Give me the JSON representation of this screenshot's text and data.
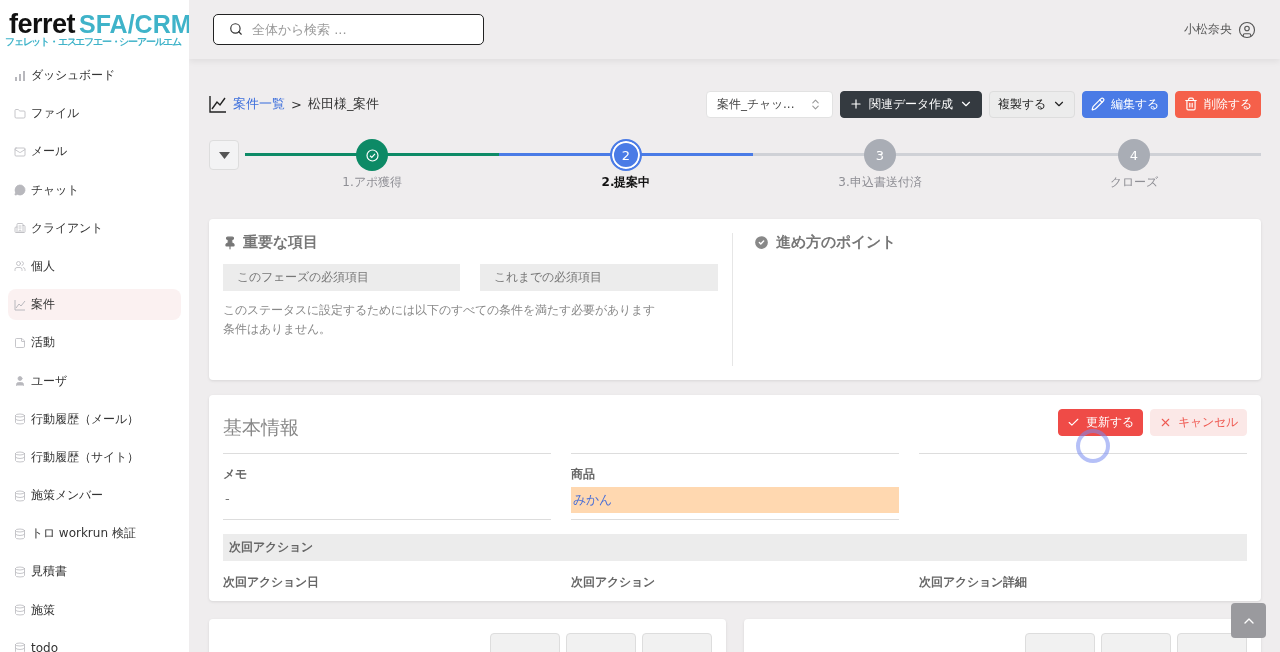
{
  "logo": {
    "brand": "ferret",
    "product": "SFA/CRM",
    "reading": "フェレット・エスエフエー・シーアールエム"
  },
  "sidebar": {
    "items": [
      {
        "label": "ダッシュボード",
        "selected": false
      },
      {
        "label": "ファイル",
        "selected": false
      },
      {
        "label": "メール",
        "selected": false
      },
      {
        "label": "チャット",
        "selected": false
      },
      {
        "label": "クライアント",
        "selected": false
      },
      {
        "label": "個人",
        "selected": false
      },
      {
        "label": "案件",
        "selected": true
      },
      {
        "label": "活動",
        "selected": false
      },
      {
        "label": "ユーザ",
        "selected": false
      },
      {
        "label": "行動履歴（メール）",
        "selected": false
      },
      {
        "label": "行動履歴（サイト）",
        "selected": false
      },
      {
        "label": "施策メンバー",
        "selected": false
      },
      {
        "label": "トロ workrun 検証",
        "selected": false
      },
      {
        "label": "見積書",
        "selected": false
      },
      {
        "label": "施策",
        "selected": false
      },
      {
        "label": "todo",
        "selected": false
      }
    ]
  },
  "header": {
    "search": {
      "placeholder": "全体から検索 ..."
    },
    "user": "小松奈央"
  },
  "breadcrumb": {
    "link": "案件一覧",
    "separator": ">",
    "current": "松田様_案件"
  },
  "toolbar": {
    "select": "案件_チャッ...",
    "buttons": [
      {
        "label": "関連データ作成",
        "kind": "create"
      },
      {
        "label": "複製する",
        "kind": "menu"
      },
      {
        "label": "編集する",
        "kind": "edit"
      },
      {
        "label": "削除する",
        "kind": "delete"
      }
    ]
  },
  "steps": [
    {
      "label": "1.アポ獲得",
      "completed": true,
      "selected": false
    },
    {
      "number": "2",
      "label": "2.提案中",
      "completed": false,
      "selected": true
    },
    {
      "number": "3",
      "label": "3.申込書送付済",
      "completed": false,
      "selected": false
    },
    {
      "number": "4",
      "label": "クローズ",
      "completed": false,
      "selected": false
    }
  ],
  "important": {
    "title": "重要な項目",
    "columns": [
      "このフェーズの必須項目",
      "これまでの必須項目"
    ],
    "message": "このステータスに設定するためには以下のすべての条件を満たす必要があります",
    "note": "条件はありません。"
  },
  "tips": {
    "title": "進め方のポイント"
  },
  "basic": {
    "title": "基本情報",
    "buttons": [
      {
        "label": "更新する",
        "kind": "save"
      },
      {
        "label": "キャンセル",
        "kind": "cancel"
      }
    ],
    "loading": true,
    "fields": [
      {
        "label": "メモ",
        "value": "-",
        "highlighted": false,
        "link": false
      },
      {
        "label": "商品",
        "value": "みかん",
        "highlighted": true,
        "link": true
      }
    ],
    "section": "次回アクション",
    "section_fields": [
      "次回アクション日",
      "次回アクション",
      "次回アクション詳細"
    ]
  }
}
